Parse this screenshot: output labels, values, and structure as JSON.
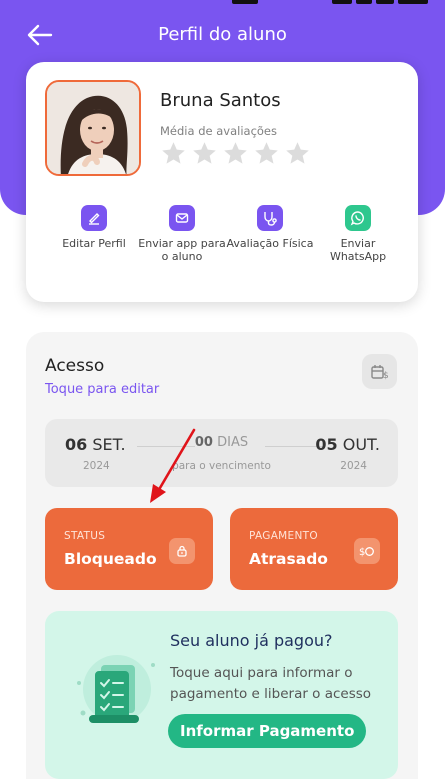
{
  "colors": {
    "brand_purple": "#7a55f0",
    "accent_orange": "#ec6a3c",
    "whatsapp_green": "#2ec78e",
    "paid_green": "#23b785",
    "annotation_red": "#e0141a"
  },
  "header": {
    "title": "Perfil do aluno",
    "back_icon": "arrow-left-icon"
  },
  "profile": {
    "name": "Bruna Santos",
    "rating_label": "Média de avaliações",
    "rating_value": 0,
    "rating_max": 5,
    "actions": [
      {
        "label": "Editar Perfil",
        "icon": "pencil-icon"
      },
      {
        "label": "Enviar app para o aluno",
        "icon": "mail-icon"
      },
      {
        "label": "Avaliação Física",
        "icon": "stethoscope-icon"
      },
      {
        "label": "Enviar WhatsApp",
        "icon": "whatsapp-icon"
      }
    ]
  },
  "access": {
    "title": "Acesso",
    "edit_link": "Toque para editar",
    "icon": "payment-card-icon",
    "start_day": "06",
    "start_month": "SET.",
    "start_year": "2024",
    "days_count": "00",
    "days_unit": "DIAS",
    "days_caption": "para o vencimento",
    "end_day": "05",
    "end_month": "OUT.",
    "end_year": "2024",
    "status": {
      "label": "STATUS",
      "value": "Bloqueado",
      "icon": "lock-icon"
    },
    "payment": {
      "label": "PAGAMENTO",
      "value": "Atrasado",
      "icon": "dollar-coin-icon"
    }
  },
  "paid_prompt": {
    "title": "Seu aluno já pagou?",
    "text": "Toque aqui para informar o pagamento e liberar o acesso",
    "button": "Informar Pagamento",
    "illustration": "receipt-checklist-icon"
  }
}
